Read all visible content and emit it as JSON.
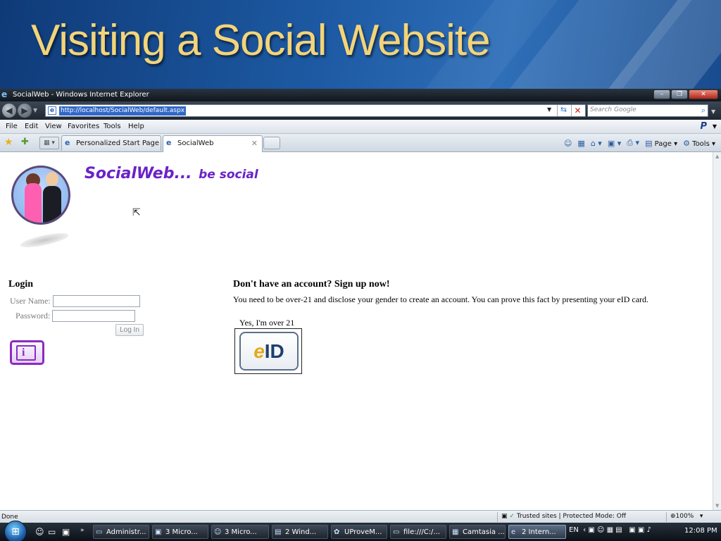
{
  "slide": {
    "title": "Visiting a Social Website"
  },
  "browser": {
    "window_title": "SocialWeb - Windows Internet Explorer",
    "address_url": "http://localhost/SocialWeb/default.aspx",
    "search_placeholder": "Search Google",
    "menus": [
      "File",
      "Edit",
      "View",
      "Favorites",
      "Tools",
      "Help"
    ],
    "tabs": [
      {
        "label": "Personalized Start Page"
      },
      {
        "label": "SocialWeb"
      }
    ],
    "commands": {
      "page": "Page",
      "tools": "Tools"
    },
    "status": {
      "left": "Done",
      "zone": "Trusted sites | Protected Mode: Off",
      "zoom": "100%"
    }
  },
  "page": {
    "brand_main": "SocialWeb...",
    "brand_tag": "be social",
    "login": {
      "heading": "Login",
      "username_label": "User Name:",
      "password_label": "Password:",
      "button": "Log In"
    },
    "signup": {
      "heading": "Don't have an account? Sign up now!",
      "text": "You need to be over-21 and disclose your gender to create an account. You can prove this fact by presenting your eID card.",
      "claim_label": "Yes, I'm over 21",
      "eid_e": "e",
      "eid_id": "ID"
    }
  },
  "taskbar": {
    "tasks": [
      "Administr...",
      "3 Micro...",
      "3 Micro...",
      "2 Wind...",
      "UProveM...",
      "file:///C:/...",
      "Camtasia ...",
      "2 Intern..."
    ],
    "lang": "EN",
    "clock": "12:08 PM"
  },
  "colors": {
    "brand": "#6a22c8",
    "title": "#f3d47a",
    "eid_accent": "#e3a917"
  },
  "icons": [
    "ie-icon",
    "back-arrow-icon",
    "forward-arrow-icon",
    "refresh-icon",
    "stop-icon",
    "search-icon",
    "favorites-star-icon",
    "add-favorite-icon",
    "tab-list-icon",
    "home-icon",
    "feeds-icon",
    "print-icon",
    "page-icon",
    "tools-gear-icon",
    "shield-icon",
    "zoom-icon",
    "windows-orb-icon"
  ]
}
